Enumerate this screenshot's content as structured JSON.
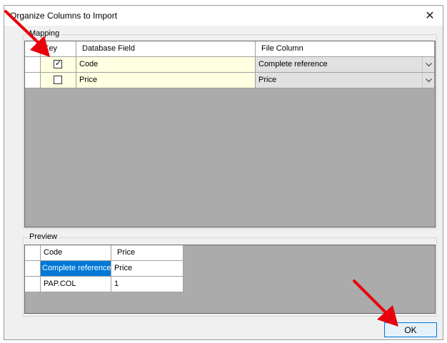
{
  "window": {
    "title": "Organize Columns to Import",
    "close_glyph": "✕"
  },
  "mapping": {
    "group_label": "Mapping",
    "headers": {
      "key": "Key",
      "database_field": "Database Field",
      "file_column": "File Column"
    },
    "rows": [
      {
        "key_checked": true,
        "database_field": "Code",
        "file_column": "Complete reference"
      },
      {
        "key_checked": false,
        "database_field": "Price",
        "file_column": "Price"
      }
    ]
  },
  "preview": {
    "group_label": "Preview",
    "headers": [
      "Code",
      "Price"
    ],
    "rows": [
      [
        "Complete reference",
        "Price"
      ],
      [
        "PAP.COL",
        "1"
      ]
    ]
  },
  "ok_label": "OK",
  "annotation_color": "#e8000b"
}
